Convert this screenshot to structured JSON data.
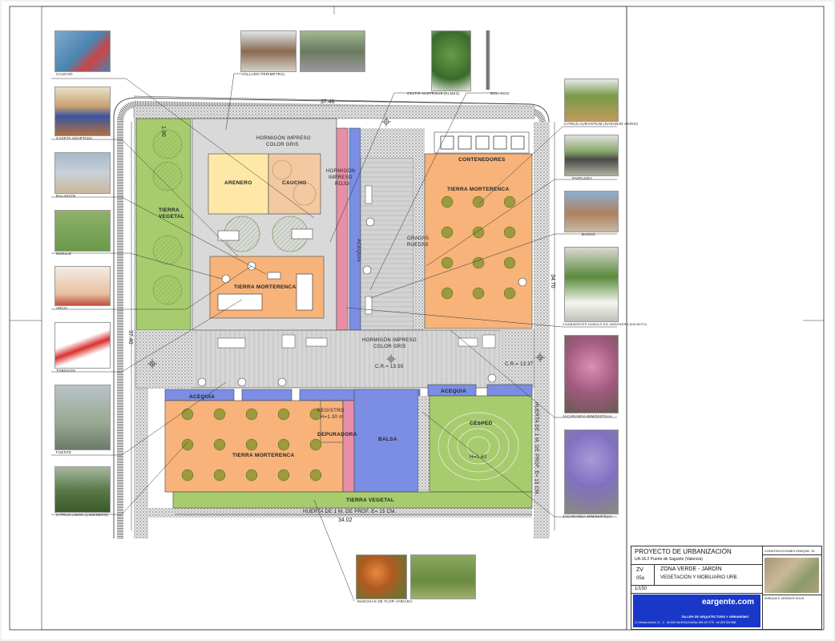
{
  "plan": {
    "dim_top": "37.46",
    "dim_bottom": "34.02",
    "dim_left": "37.40",
    "dim_right": "34.70",
    "dim_small_top": "1.90",
    "zones": {
      "hormigon_top_1": "HORMIGÓN IMPRESO",
      "hormigon_top_2": "COLOR GRIS",
      "arenero": "ARENERO",
      "caucho": "CAUCHO",
      "hormigon_rojo_1": "HORMIGÓN",
      "hormigon_rojo_2": "IMPRESO",
      "hormigon_rojo_3": "ROJO",
      "tierra_vegetal_1": "TIERRA",
      "tierra_vegetal_2": "VEGETAL",
      "tierra_morterenca_play": "TIERRA MORTERENCA",
      "acequia_v": "ACEQUIA",
      "gradas_1": "GRADAS",
      "gradas_2": "RUEDAS",
      "contenedores": "CONTENEDORES",
      "tierra_morterenca_right": "TIERRA MORTERENCA",
      "hormigon_mid_1": "HORMIGÓN IMPRESO",
      "hormigon_mid_2": "COLOR GRIS",
      "cr_left": "C.R.= 13.55",
      "cr_right": "C.R.= 13.37",
      "acequia_left": "ACEQUIA",
      "acequia_right": "ACEQUIA",
      "registro_1": "REGISTRO",
      "registro_2": "H=1.30 m",
      "depuradora": "DEPURADORA",
      "balsa": "BALSA",
      "cesped": "CÉSPED",
      "cesped_h": "H=0.60",
      "tierra_morterenca_bottom": "TIERRA MORTERENCA",
      "tierra_vegetal_bottom": "TIERRA VEGETAL",
      "hueta_bottom": "HUERTA DE 1 M. DE PROF. E= 15 CM.",
      "hueta_right": "HUERTA DE 1 M. DE PROF. E= 15 CM."
    }
  },
  "photos": {
    "caucho": "CAUCHO",
    "caseta": "CASETA ADAPTADA",
    "balancin": "BALANCÍN",
    "muelle": "MUELLE",
    "arco": "ARCO",
    "tobogan": "TOBOGÁN",
    "fuente": "FUENTE",
    "citrus_limon": "CITRUS LIMON (LIMONERO)",
    "vallado": "VALLADO PERIMETRAL",
    "celtis": "CELTIS AUSTRALIS (ALMEZ)",
    "bolardo": "BOLARDO",
    "citrus_aurantium": "CITRUS AURANTIUM (NARANJO AGRIO)",
    "papelera": "PAPELERA",
    "banco": "BANCO",
    "chamaerops": "CHAMAEROPS HUMILIS EN JARDINERA (PALMITO)",
    "jacaranda_1": "JACARANDA MIMOSIFOLIA",
    "jacaranda_2": "JACARANDA MIMOSIFOLIA",
    "manchas": "MANCHAS DE FLOR VARIADA"
  },
  "titleblock": {
    "project": "PROYECTO DE URBANIZACIÓN",
    "location": "UA-16.2 Puerto de Sagunto (Valencia)",
    "promotor_label": "CONSTRUCCIONES IONIQUE, SL",
    "code": "ZV",
    "sheet_no": "05a",
    "title_1": "ZONA VERDE - JARDÍN",
    "title_2": "VEGETACIÓN Y MOBILIARIO URB.",
    "scale": "1/150",
    "brand": "eargente.com",
    "studio": "TALLER DE ARQUITECTURA Y URBANISMO",
    "address": "C/ Literato Azorín 11 - 2 - 46 006 VALENCIA   tel/fax 963 447 070 - tel 620 324 858",
    "architect": "ENRIQUE E. ARGENTE SOLIS"
  }
}
